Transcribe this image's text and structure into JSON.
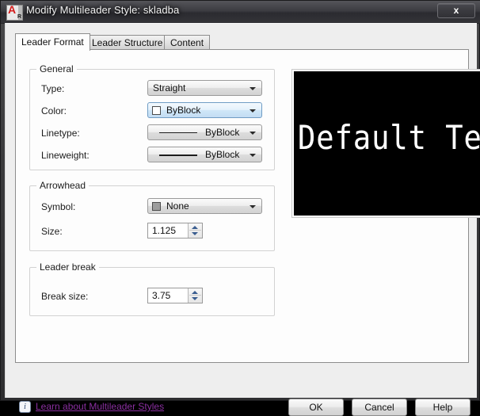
{
  "window": {
    "title": "Modify Multileader Style: skladba",
    "icon": "autocad-app-icon",
    "close_label": "x",
    "frame_color": "#3a3a3c",
    "client_bg": "#eeeeee"
  },
  "tabs": [
    {
      "label": "Leader Format",
      "active": true
    },
    {
      "label": "Leader Structure",
      "active": false
    },
    {
      "label": "Content",
      "active": false
    }
  ],
  "groups": {
    "general": {
      "title": "General",
      "rows": [
        {
          "label": "Type:",
          "value": "Straight",
          "control": "combobox"
        },
        {
          "label": "Color:",
          "value": "ByBlock",
          "control": "combobox",
          "swatch": "#ffffff",
          "focused": true
        },
        {
          "label": "Linetype:",
          "value": "ByBlock",
          "control": "combobox",
          "sample": "solid-line"
        },
        {
          "label": "Lineweight:",
          "value": "ByBlock",
          "control": "combobox",
          "sample": "solid-line"
        }
      ]
    },
    "arrowhead": {
      "title": "Arrowhead",
      "rows": [
        {
          "label": "Symbol:",
          "value": "None",
          "control": "combobox",
          "swatch": "#9d9d9d"
        },
        {
          "label": "Size:",
          "value": "1.125",
          "control": "spinner"
        }
      ]
    },
    "leader_break": {
      "title": "Leader break",
      "rows": [
        {
          "label": "Break size:",
          "value": "3.75",
          "control": "spinner"
        }
      ]
    }
  },
  "preview": {
    "text": "Default Text",
    "background": "#000000",
    "foreground": "#ffffff"
  },
  "footer": {
    "info_icon": "info-icon",
    "info_glyph": "i",
    "link_label": "Learn about Multileader Styles",
    "link_color": "#8a2fa0",
    "buttons": [
      {
        "label": "OK",
        "name": "ok-button"
      },
      {
        "label": "Cancel",
        "name": "cancel-button"
      },
      {
        "label": "Help",
        "name": "help-button"
      }
    ]
  }
}
